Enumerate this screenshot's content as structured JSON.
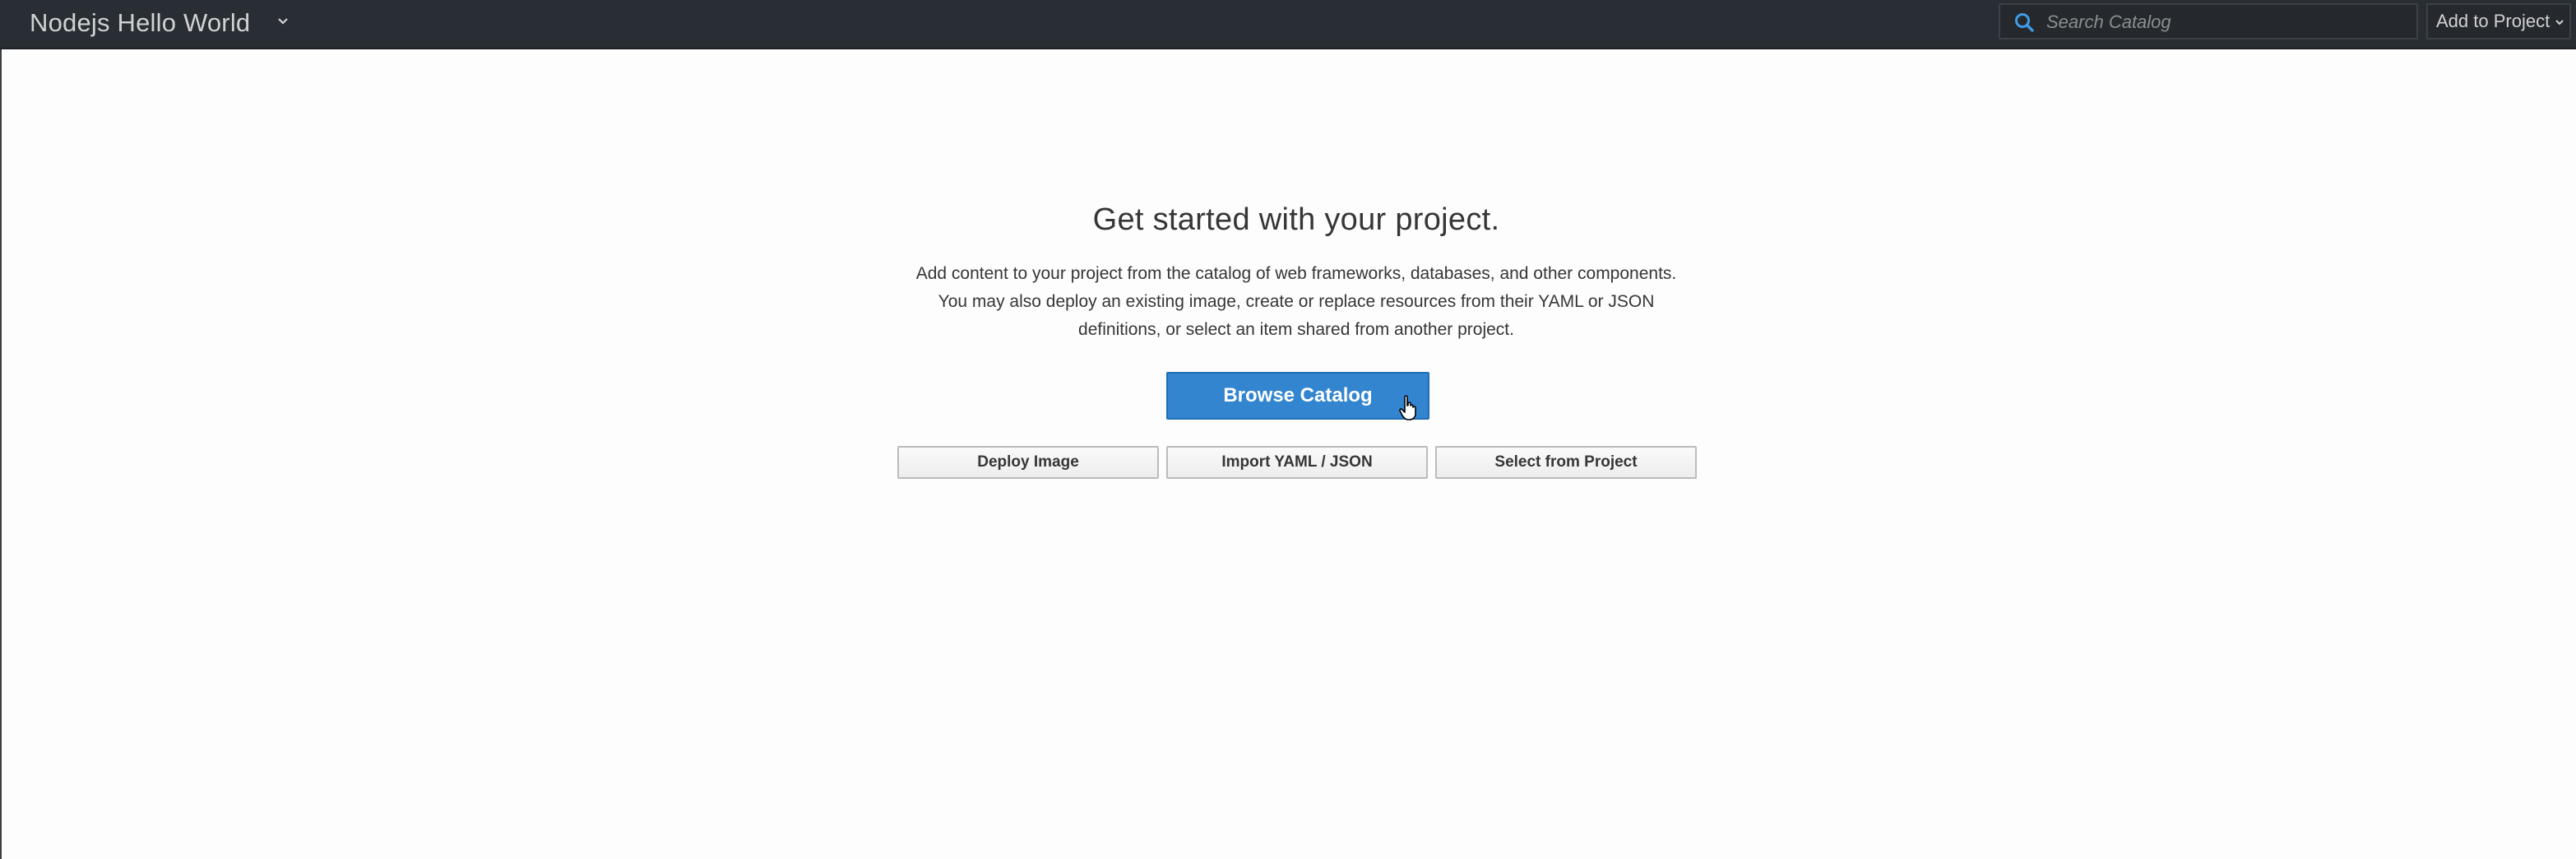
{
  "header": {
    "project_name": "Nodejs Hello World",
    "project_switch_icon": "chevron-down-icon",
    "search": {
      "placeholder": "Search Catalog",
      "value": "",
      "icon": "search-icon"
    },
    "add_to_project_label": "Add to Project",
    "add_to_project_icon": "chevron-down-icon"
  },
  "empty_state": {
    "title": "Get started with your project.",
    "description": "Add content to your project from the catalog of web frameworks, databases, and other components. You may also deploy an existing image, create or replace resources from their YAML or JSON definitions, or select an item shared from another project.",
    "primary_action": "Browse Catalog",
    "secondary_actions": [
      "Deploy Image",
      "Import YAML / JSON",
      "Select from Project"
    ]
  },
  "colors": {
    "topbar_bg": "#292e34",
    "primary_button": "#3385d0",
    "page_bg": "#fdfdfd"
  }
}
